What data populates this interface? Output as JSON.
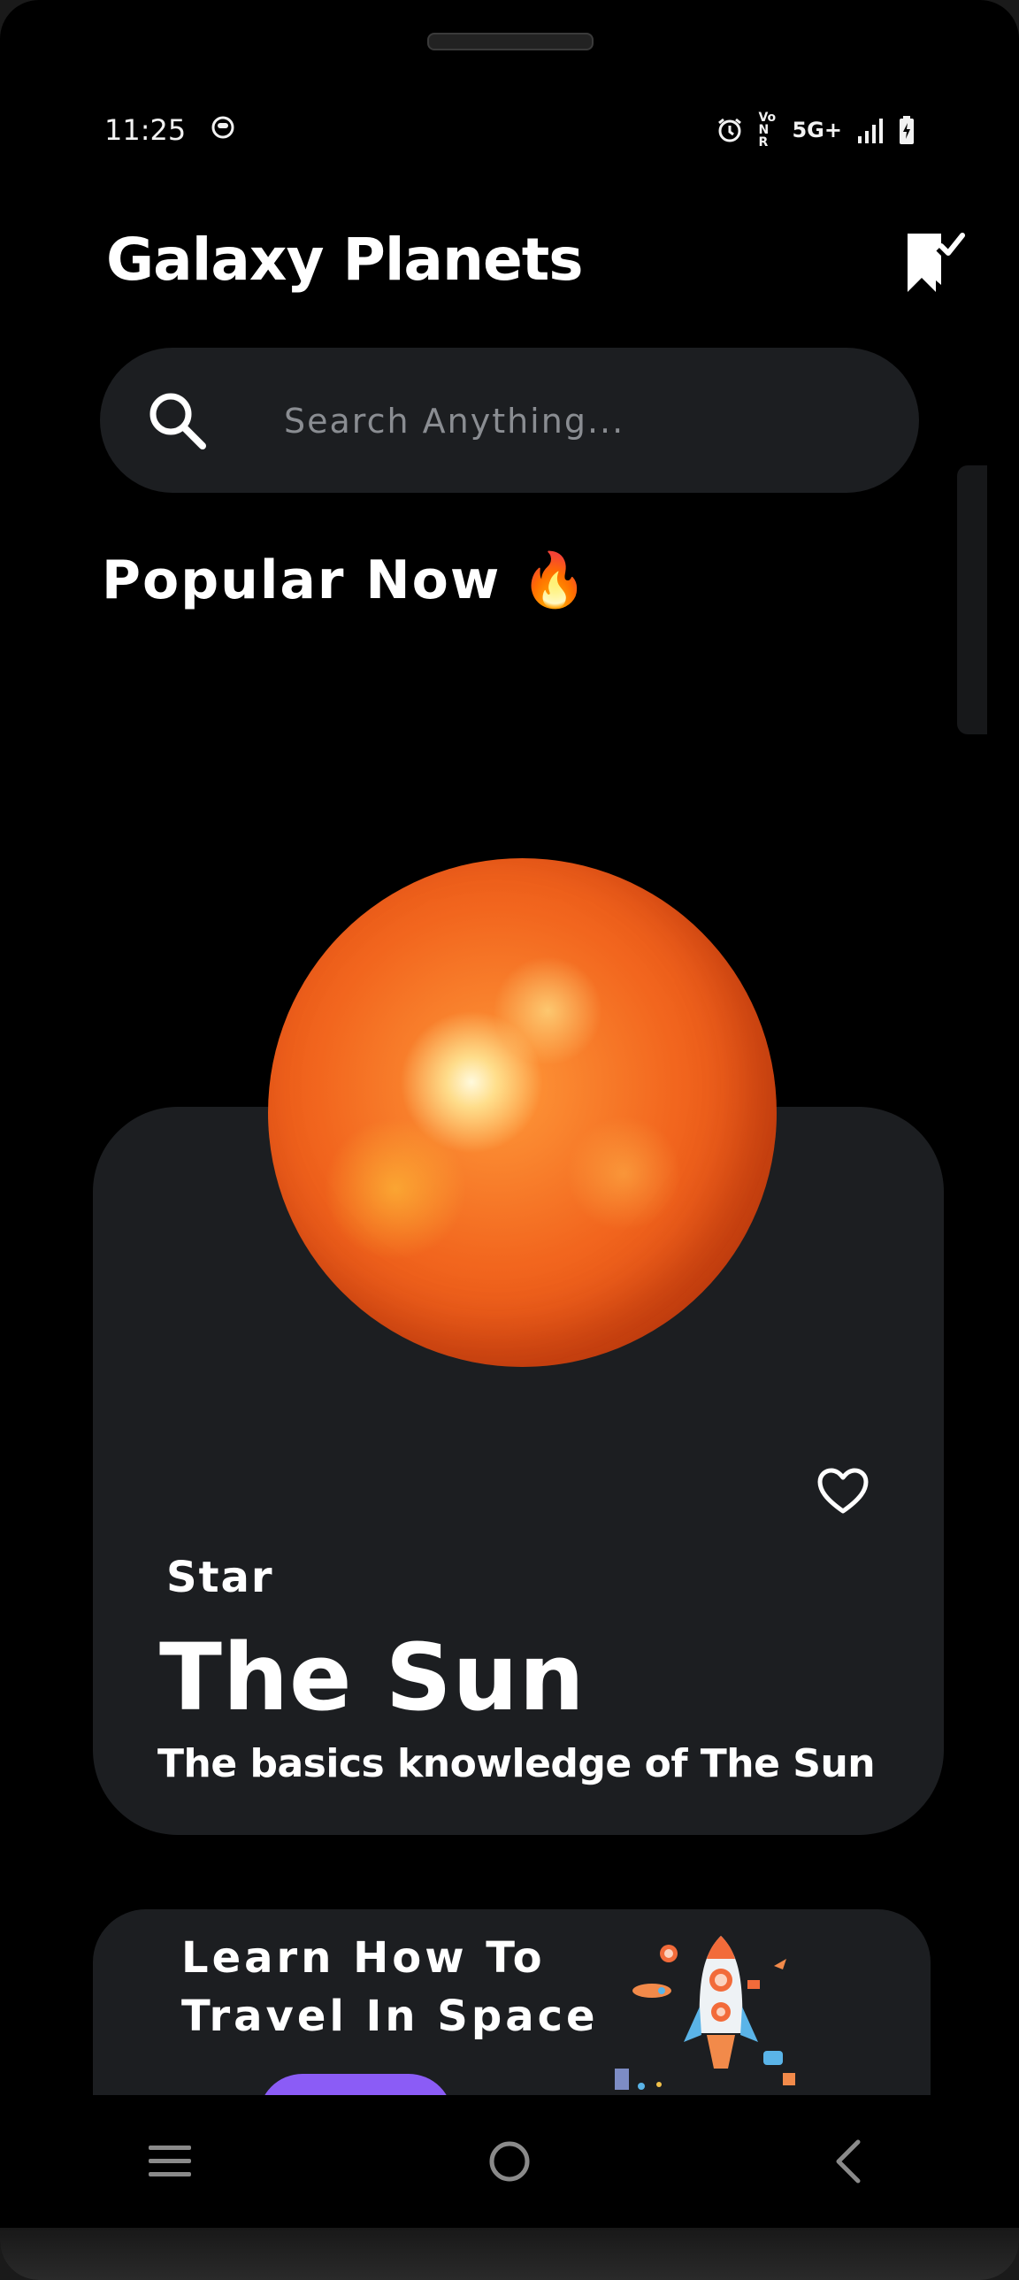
{
  "status_bar": {
    "time": "11:25",
    "network": "5G+",
    "volte": "Vo NR",
    "icons": [
      "notification-app-icon",
      "alarm-icon",
      "volte-icon",
      "signal-icon",
      "battery-charging-icon"
    ]
  },
  "header": {
    "title": "Galaxy Planets",
    "bookmark_icon": "bookmark-check-icon"
  },
  "search": {
    "placeholder": "Search Anything...",
    "icon": "search-icon"
  },
  "popular": {
    "title": "Popular Now 🔥"
  },
  "featured_card": {
    "category": "Star",
    "title": "The Sun",
    "description": "The basics knowledge of The Sun",
    "favorite_icon": "heart-outline-icon",
    "image": "sun-planet-image"
  },
  "promo_card": {
    "title": "Learn How To Travel In Space",
    "art": "rocket-illustration",
    "button_color": "#8b5cf6"
  },
  "nav_bar": {
    "icons": [
      "menu-icon",
      "home-icon",
      "back-icon"
    ]
  },
  "colors": {
    "background": "#000000",
    "surface": "#1c1e21",
    "text": "#ffffff",
    "placeholder": "#8a8d92",
    "accent": "#8b5cf6"
  }
}
